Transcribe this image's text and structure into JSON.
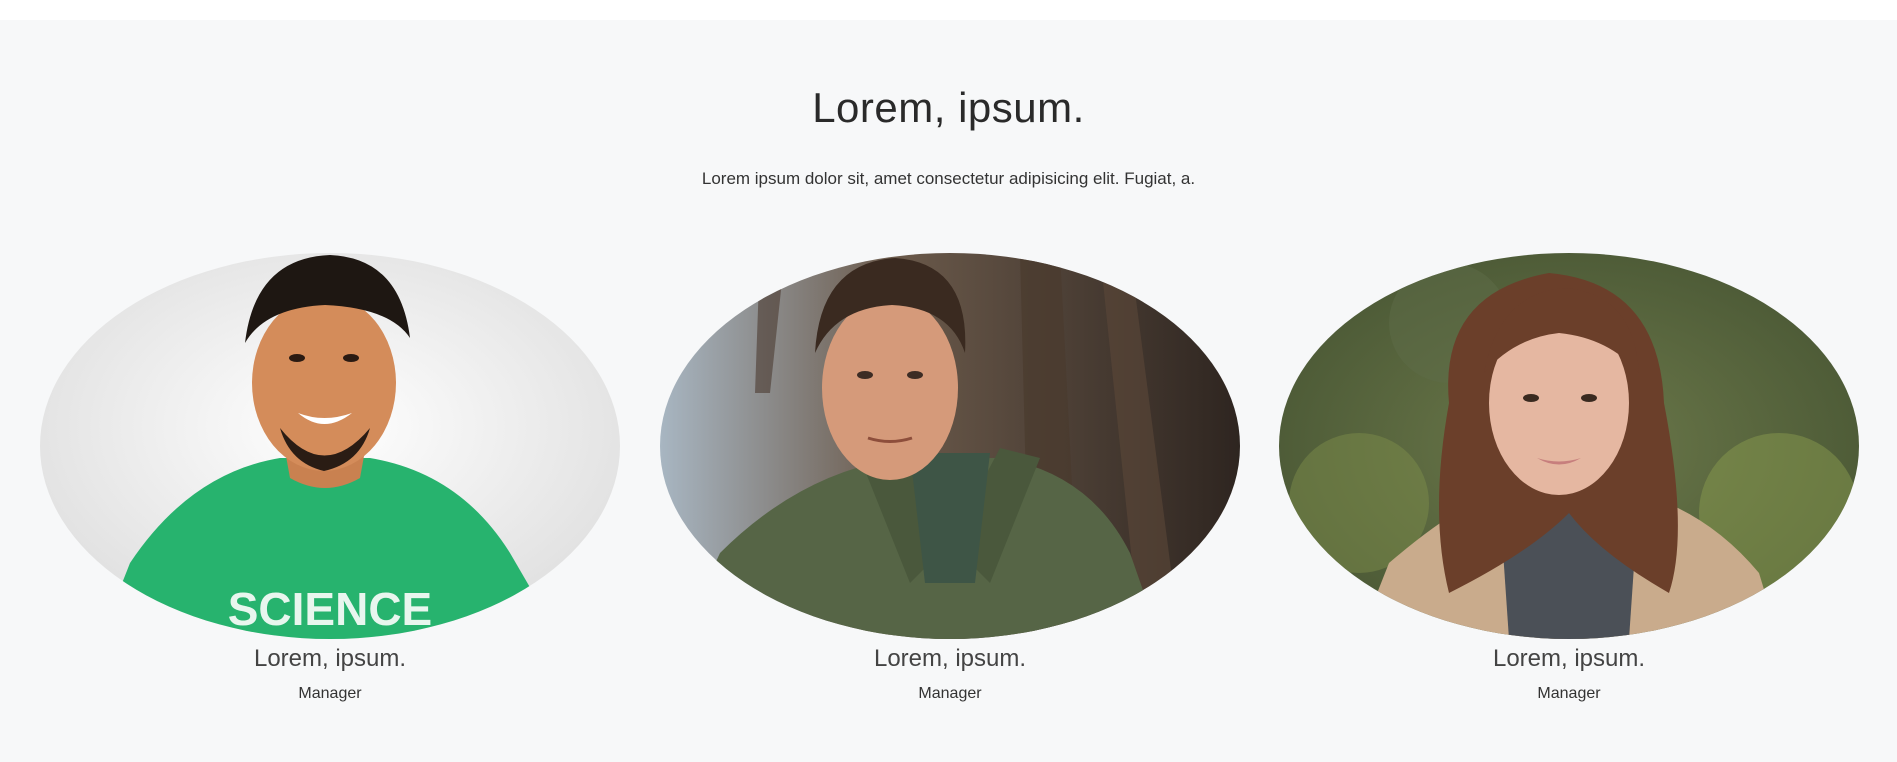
{
  "section": {
    "title": "Lorem, ipsum.",
    "subtitle": "Lorem ipsum dolor sit, amet consectetur adipisicing elit. Fugiat, a."
  },
  "members": [
    {
      "name": "Lorem, ipsum.",
      "role": "Manager",
      "image": "portrait-photo-man-green-shirt",
      "shirt_text": "SCIENCE"
    },
    {
      "name": "Lorem, ipsum.",
      "role": "Manager",
      "image": "portrait-photo-man-olive-jacket"
    },
    {
      "name": "Lorem, ipsum.",
      "role": "Manager",
      "image": "portrait-photo-woman-long-hair"
    }
  ],
  "colors": {
    "section_background": "#f7f8f9",
    "text": "#2a2a2a"
  }
}
